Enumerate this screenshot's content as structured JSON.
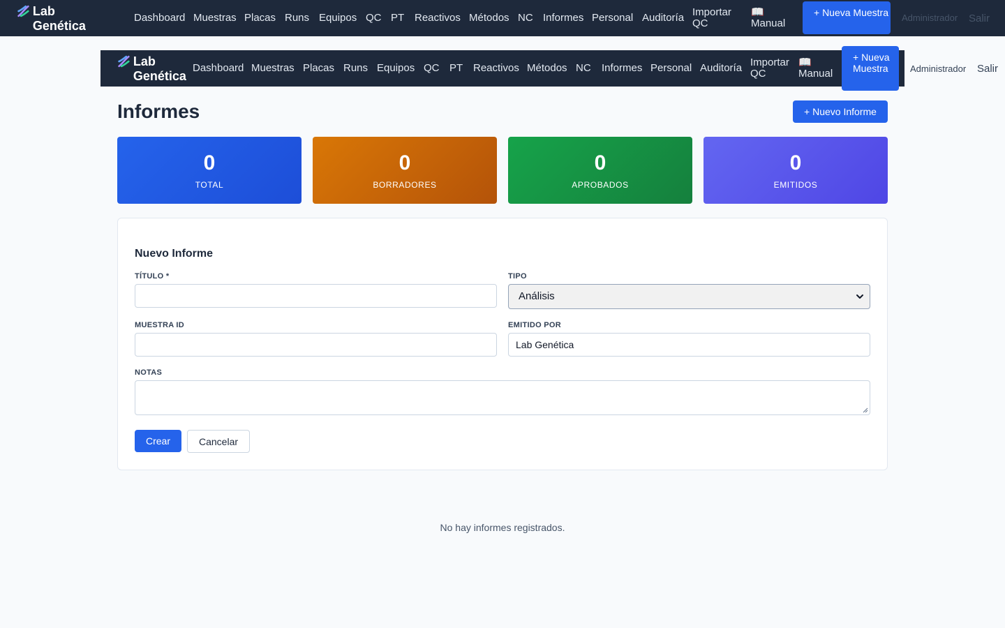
{
  "app": {
    "brand": "Lab Genética"
  },
  "nav": {
    "links": [
      "Dashboard",
      "Muestras",
      "Placas",
      "Runs",
      "Equipos",
      "QC",
      "PT",
      "Reactivos",
      "Métodos",
      "NC",
      "Informes",
      "Personal",
      "Auditoría"
    ],
    "importar_qc": "Importar QC",
    "manual": "📖 Manual",
    "nueva_muestra": "+ Nueva Muestra",
    "user": "Administrador",
    "logout": "Salir"
  },
  "page": {
    "title": "Informes",
    "new_button": "+ Nuevo Informe"
  },
  "stats": [
    {
      "value": "0",
      "label": "TOTAL",
      "color": "#2563eb"
    },
    {
      "value": "0",
      "label": "BORRADORES",
      "color": "#d97706"
    },
    {
      "value": "0",
      "label": "APROBADOS",
      "color": "#16a34a"
    },
    {
      "value": "0",
      "label": "EMITIDOS",
      "color": "#6366f1"
    }
  ],
  "form": {
    "title": "Nuevo Informe",
    "titulo_label": "TÍTULO *",
    "titulo_value": "",
    "tipo_label": "TIPO",
    "tipo_value": "Análisis",
    "muestra_label": "MUESTRA ID",
    "muestra_value": "",
    "emitido_label": "EMITIDO POR",
    "emitido_value": "Lab Genética",
    "notas_label": "NOTAS",
    "notas_value": "",
    "create_button": "Crear",
    "cancel_button": "Cancelar"
  },
  "empty_message": "No hay informes registrados."
}
